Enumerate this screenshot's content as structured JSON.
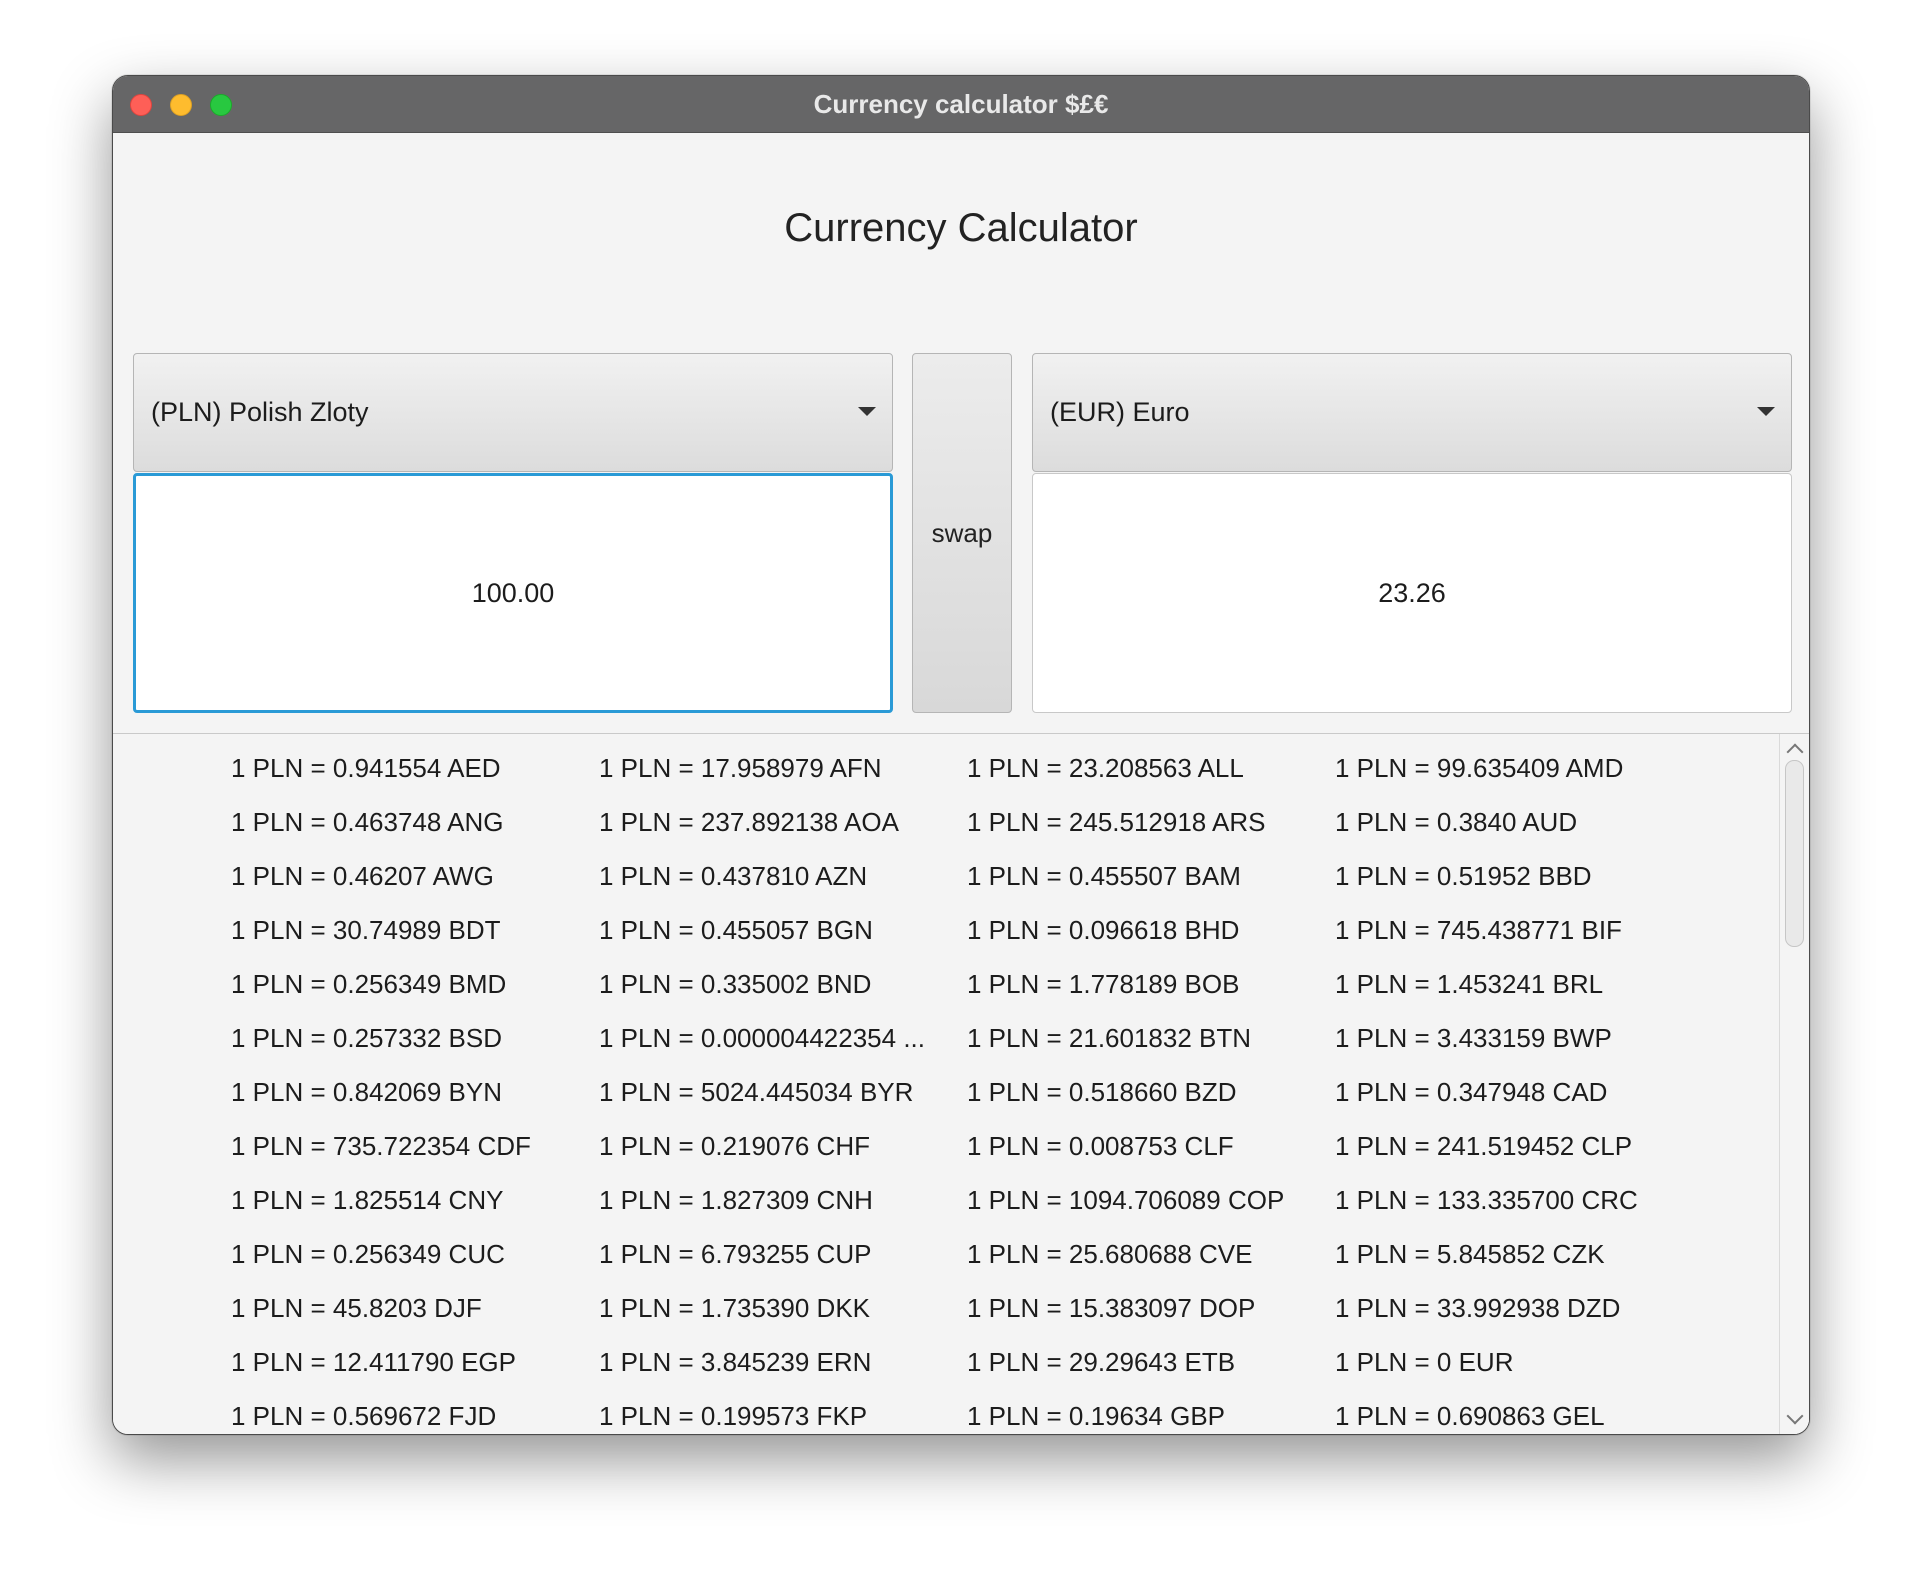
{
  "window": {
    "title": "Currency calculator $£€"
  },
  "heading": "Currency Calculator",
  "from": {
    "currency": "(PLN) Polish Zloty",
    "amount": "100.00"
  },
  "to": {
    "currency": "(EUR) Euro",
    "amount": "23.26"
  },
  "swap_label": "swap",
  "rates": [
    "1 PLN = 0.941554 AED",
    "1 PLN = 17.958979 AFN",
    "1 PLN = 23.208563 ALL",
    "1 PLN = 99.635409 AMD",
    "1 PLN = 0.463748 ANG",
    "1 PLN = 237.892138 AOA",
    "1 PLN = 245.512918 ARS",
    "1 PLN = 0.3840 AUD",
    "1 PLN = 0.46207 AWG",
    "1 PLN = 0.437810 AZN",
    "1 PLN = 0.455507 BAM",
    "1 PLN = 0.51952 BBD",
    "1 PLN = 30.74989 BDT",
    "1 PLN = 0.455057 BGN",
    "1 PLN = 0.096618 BHD",
    "1 PLN = 745.438771 BIF",
    "1 PLN = 0.256349 BMD",
    "1 PLN = 0.335002 BND",
    "1 PLN = 1.778189 BOB",
    "1 PLN = 1.453241 BRL",
    "1 PLN = 0.257332 BSD",
    "1 PLN = 0.000004422354 ...",
    "1 PLN = 21.601832 BTN",
    "1 PLN = 3.433159 BWP",
    "1 PLN = 0.842069 BYN",
    "1 PLN = 5024.445034 BYR",
    "1 PLN = 0.518660 BZD",
    "1 PLN = 0.347948 CAD",
    "1 PLN = 735.722354 CDF",
    "1 PLN = 0.219076 CHF",
    "1 PLN = 0.008753 CLF",
    "1 PLN = 241.519452 CLP",
    "1 PLN = 1.825514 CNY",
    "1 PLN = 1.827309 CNH",
    "1 PLN = 1094.706089 COP",
    "1 PLN = 133.335700 CRC",
    "1 PLN = 0.256349 CUC",
    "1 PLN = 6.793255 CUP",
    "1 PLN = 25.680688 CVE",
    "1 PLN = 5.845852 CZK",
    "1 PLN = 45.8203 DJF",
    "1 PLN = 1.735390 DKK",
    "1 PLN = 15.383097 DOP",
    "1 PLN = 33.992938 DZD",
    "1 PLN = 12.411790 EGP",
    "1 PLN = 3.845239 ERN",
    "1 PLN = 29.29643 ETB",
    "1 PLN = 0 EUR",
    "1 PLN = 0.569672 FJD",
    "1 PLN = 0.199573 FKP",
    "1 PLN = 0.19634 GBP",
    "1 PLN = 0.690863 GEL"
  ]
}
